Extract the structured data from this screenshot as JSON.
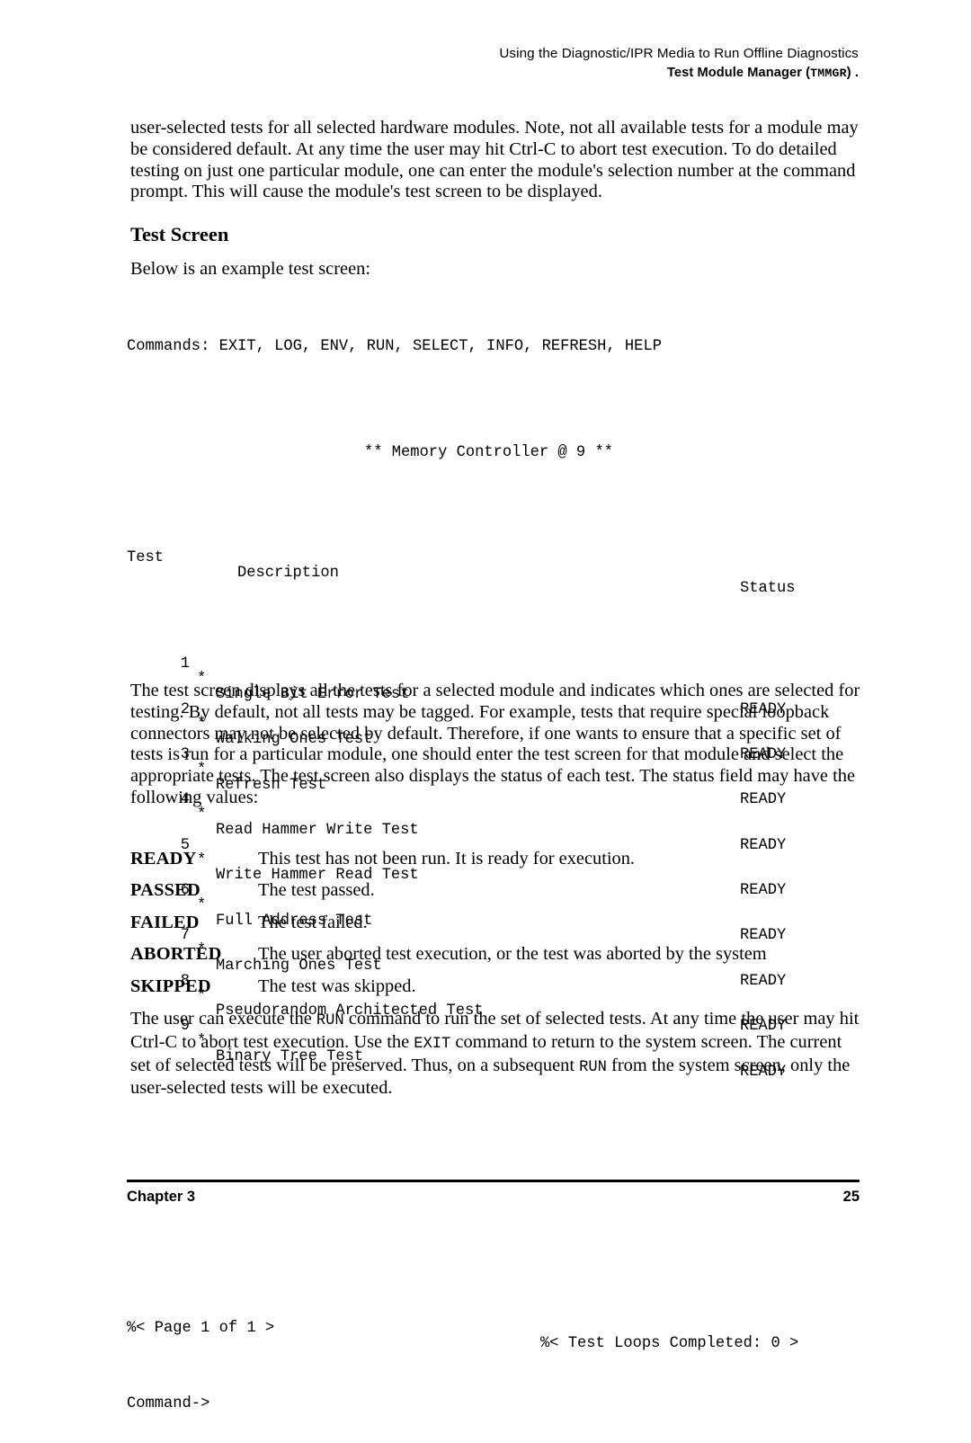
{
  "header": {
    "running_title": "Using the Diagnostic/IPR Media to Run Offline Diagnostics",
    "subtitle_prefix": "Test Module Manager (",
    "subtitle_mono": "TMMGR",
    "subtitle_suffix": ") ."
  },
  "intro_paragraph": "user-selected tests for all selected hardware modules. Note, not all available tests for a module may be considered default. At any time the user may hit Ctrl-C to abort test execution. To do detailed testing on just one particular module, one can enter the module's selection number at the command prompt. This will cause the module's test screen to be displayed.",
  "section": {
    "heading": "Test Screen",
    "lead_in": "Below is an example test screen:"
  },
  "screen": {
    "commands_line": "Commands: EXIT, LOG, ENV, RUN, SELECT, INFO, REFRESH, HELP",
    "module_title": "** Memory Controller @ 9 **",
    "columns": {
      "test": "Test",
      "description": "Description",
      "status": "Status"
    },
    "rows": [
      {
        "num": "1",
        "tag": "*",
        "description": "Single Bit Error Test",
        "status": "READY"
      },
      {
        "num": "2",
        "tag": "*",
        "description": "Walking Ones Test",
        "status": "READY"
      },
      {
        "num": "3",
        "tag": "*",
        "description": "Refresh Test",
        "status": "READY"
      },
      {
        "num": "4",
        "tag": "*",
        "description": "Read Hammer Write Test",
        "status": "READY"
      },
      {
        "num": "5",
        "tag": "*",
        "description": "Write Hammer Read Test",
        "status": "READY"
      },
      {
        "num": "6",
        "tag": "*",
        "description": "Full Address Test",
        "status": "READY"
      },
      {
        "num": "7",
        "tag": "*",
        "description": "Marching Ones Test",
        "status": "READY"
      },
      {
        "num": "8",
        "tag": "*",
        "description": "Pseudorandom Architected Test",
        "status": "READY"
      },
      {
        "num": "9",
        "tag": "*",
        "description": "Binary Tree Test",
        "status": "READY"
      }
    ],
    "page_indicator": "%< Page 1 of 1 >",
    "loops_indicator": "%< Test Loops Completed: 0 >",
    "prompt": "Command->"
  },
  "explanation_paragraph": "The test screen displays all the tests for a selected module and indicates which ones are selected for testing. By default, not all tests may be tagged. For example, tests that require special loopback connectors may not be selected by default. Therefore, if one wants to ensure that a specific set of tests is run for a particular module, one should enter the test screen for that module and select the appropriate tests. The test screen also displays the status of each test. The status field may have the following values:",
  "status_definitions": [
    {
      "term": "READY",
      "description": "This test has not been run. It is ready for execution."
    },
    {
      "term": "PASSED",
      "description": "The test passed."
    },
    {
      "term": "FAILED",
      "description": "The test failed."
    },
    {
      "term": "ABORTED",
      "description": "The user aborted test execution, or the test was aborted by the system"
    },
    {
      "term": "SKIPPED",
      "description": "The test was skipped."
    }
  ],
  "closing_paragraph": {
    "part1": "The user can execute the ",
    "cmd1": "RUN",
    "part2": " command to run the set of selected tests. At any time the user may hit Ctrl-C to abort test execution. Use the ",
    "cmd2": "EXIT",
    "part3": " command to return to the system screen. The current set of selected tests will be preserved. Thus, on a subsequent ",
    "cmd3": "RUN",
    "part4": " from the system screen, only the user-selected tests will be executed."
  },
  "footer": {
    "chapter": "Chapter 3",
    "page_number": "25"
  }
}
